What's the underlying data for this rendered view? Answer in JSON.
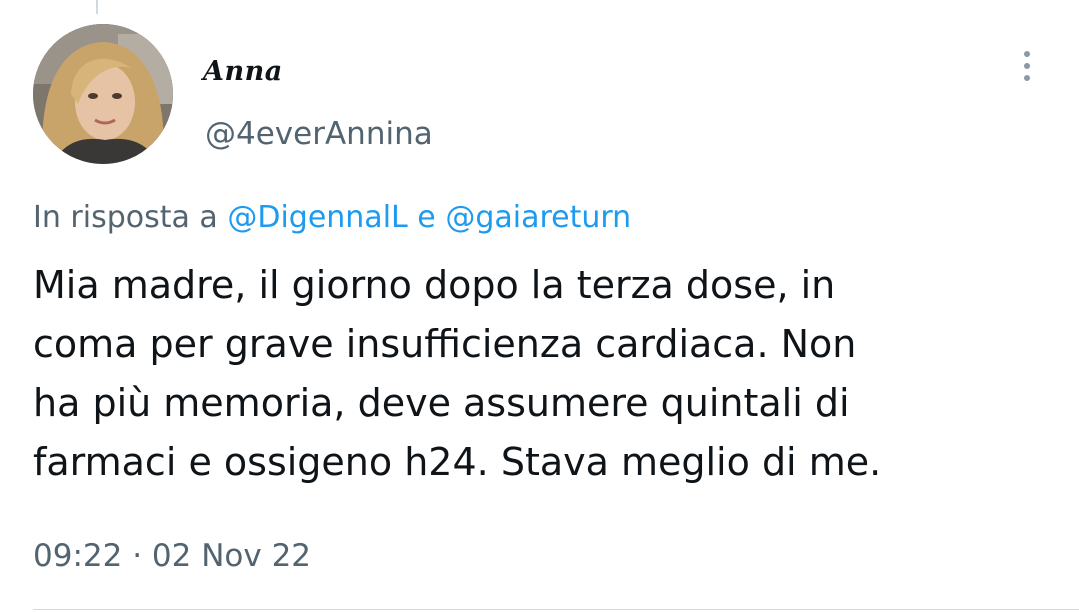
{
  "tweet": {
    "author": {
      "display_name": "Anna",
      "handle": "@4everAnnina"
    },
    "reply_context": {
      "prefix": "In risposta a",
      "mention_1": "@DigennalL",
      "connector": "e",
      "mention_2": "@gaiareturn"
    },
    "text_lines": [
      "Mia madre, il giorno dopo la terza dose, in",
      "coma per grave insufficienza cardiaca. Non",
      "ha più memoria, deve assumere quintali di",
      "farmaci e ossigeno h24. Stava meglio di me."
    ],
    "timestamp": {
      "time": "09:22",
      "separator": "·",
      "date": "02 Nov 22"
    }
  },
  "icons": {
    "more": "more-vertical-icon"
  },
  "colors": {
    "text_primary": "#0f1419",
    "text_secondary": "#536471",
    "link": "#1d9bf0",
    "divider": "#cfd9de"
  }
}
